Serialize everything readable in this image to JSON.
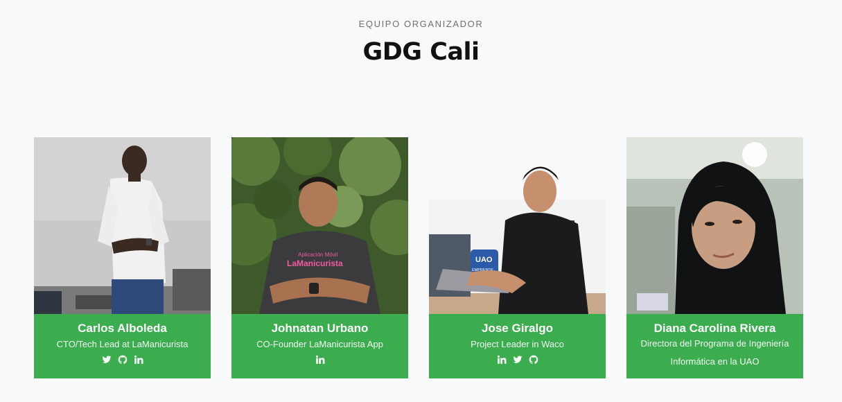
{
  "section": {
    "eyebrow": "EQUIPO ORGANIZADOR",
    "title": "GDG Cali"
  },
  "colors": {
    "card_accent": "#3cad4f",
    "background": "#f8f9fb"
  },
  "members": [
    {
      "name": "Carlos Alboleda",
      "role": "CTO/Tech Lead at LaManicurista",
      "socials": [
        "twitter-icon",
        "github-icon",
        "linkedin-icon"
      ]
    },
    {
      "name": "Johnatan Urbano",
      "role": "CO-Founder LaManicurista App",
      "socials": [
        "linkedin-icon"
      ]
    },
    {
      "name": "Jose Giralgo",
      "role": "Project Leader in Waco",
      "socials": [
        "linkedin-icon",
        "twitter-icon",
        "github-icon"
      ]
    },
    {
      "name": "Diana Carolina Rivera",
      "role": "Directora del Programa de Ingeniería Informática en la UAO",
      "socials": []
    }
  ],
  "photo_text": {
    "shirt_line1": "Aplicación Móvil",
    "shirt_line2": "LaManicurista",
    "sign_line1": "UAO",
    "sign_line2": "EMPRENDE"
  }
}
